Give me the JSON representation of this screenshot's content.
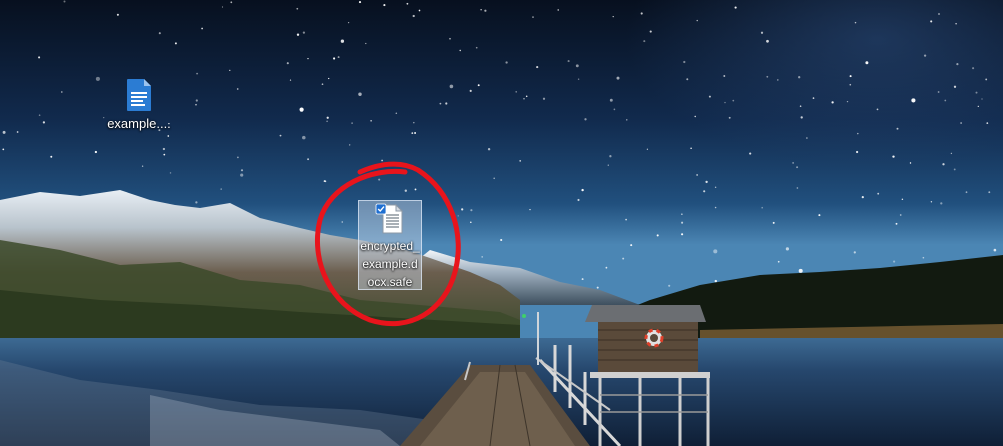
{
  "desktop": {
    "icons": [
      {
        "label": "example....",
        "icon": "word-document-icon"
      },
      {
        "label": "encrypted_example.docx.safe",
        "icon": "document-icon",
        "selected": true,
        "checked": true
      }
    ],
    "annotation": {
      "shape": "circle",
      "color": "#e8141c"
    }
  },
  "colors": {
    "sky_top": "#0a1424",
    "sky_mid": "#16325a",
    "horizon": "#3a6f9c",
    "lake": "#1d3a5c",
    "selection": "#cddaeb",
    "word_blue": "#2b7cd3"
  }
}
